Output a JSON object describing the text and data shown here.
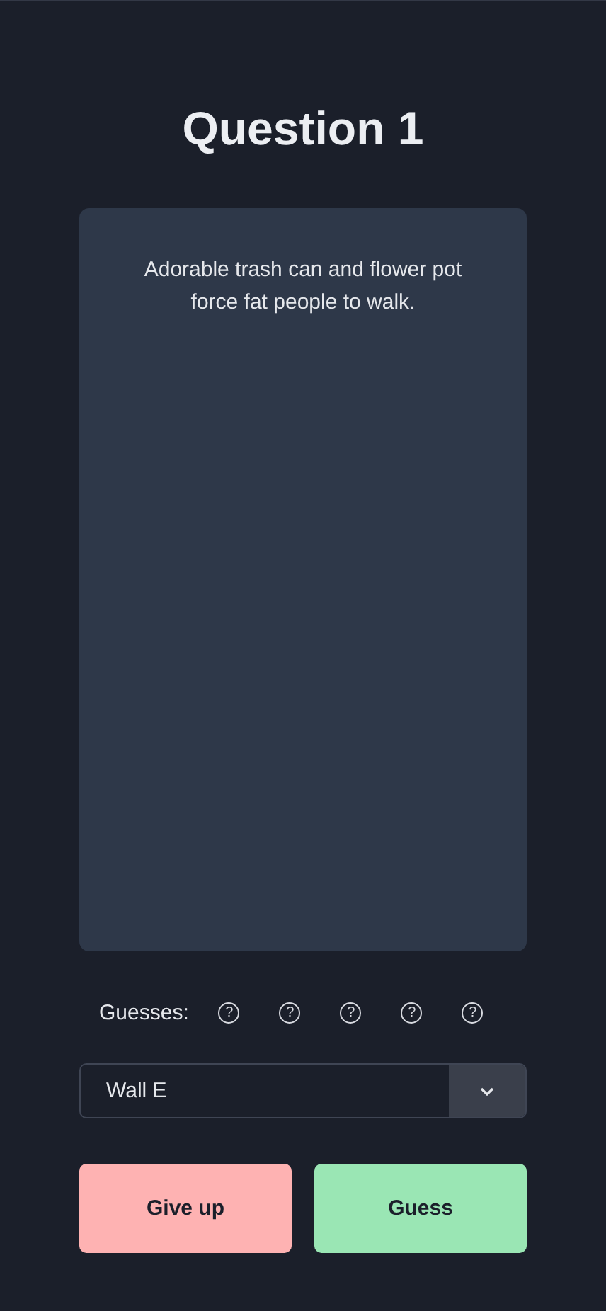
{
  "title": "Question 1",
  "clue": "Adorable trash can and flower pot force fat people to walk.",
  "guesses": {
    "label": "Guesses:",
    "items": [
      {
        "kind": "pending",
        "symbol": "?"
      },
      {
        "kind": "pending",
        "symbol": "?"
      },
      {
        "kind": "pending",
        "symbol": "?"
      },
      {
        "kind": "pending",
        "symbol": "?"
      },
      {
        "kind": "pending",
        "symbol": "?"
      }
    ]
  },
  "answer": {
    "value": "Wall E"
  },
  "buttons": [
    {
      "label": "Give up",
      "kind": "giveup"
    },
    {
      "label": "Guess",
      "kind": "guess"
    }
  ]
}
